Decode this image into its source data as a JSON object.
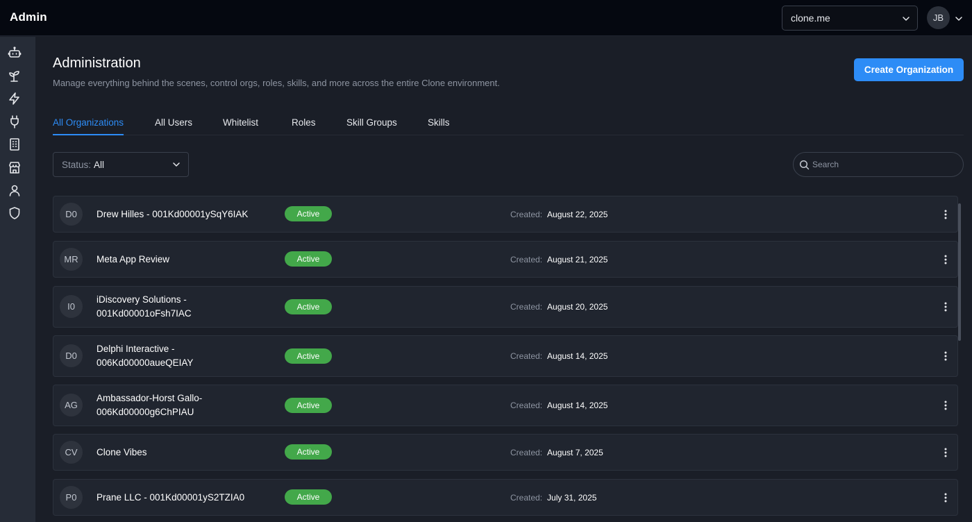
{
  "app": {
    "title": "Admin"
  },
  "header": {
    "org_selector": "clone.me",
    "user_initials": "JB"
  },
  "sidebar": {
    "items": [
      {
        "icon": "robot-icon"
      },
      {
        "icon": "sprout-icon"
      },
      {
        "icon": "lightning-icon"
      },
      {
        "icon": "plug-icon"
      },
      {
        "icon": "building-icon"
      },
      {
        "icon": "store-icon"
      },
      {
        "icon": "user-icon"
      },
      {
        "icon": "shield-icon"
      }
    ]
  },
  "page": {
    "title": "Administration",
    "subtitle": "Manage everything behind the scenes, control orgs, roles, skills, and more across the entire Clone environment.",
    "create_button": "Create Organization"
  },
  "tabs": [
    {
      "label": "All Organizations",
      "active": true
    },
    {
      "label": "All Users",
      "active": false
    },
    {
      "label": "Whitelist",
      "active": false
    },
    {
      "label": "Roles",
      "active": false
    },
    {
      "label": "Skill Groups",
      "active": false
    },
    {
      "label": "Skills",
      "active": false
    }
  ],
  "filters": {
    "status_label": "Status:",
    "status_value": "All",
    "search_placeholder": "Search"
  },
  "organizations": [
    {
      "initials": "D0",
      "name_line1": "Drew Hilles - 001Kd00001ySqY6IAK",
      "name_line2": "",
      "status": "Active",
      "created_label": "Created:",
      "created": "August 22, 2025"
    },
    {
      "initials": "MR",
      "name_line1": "Meta App Review",
      "name_line2": "",
      "status": "Active",
      "created_label": "Created:",
      "created": "August 21, 2025"
    },
    {
      "initials": "I0",
      "name_line1": "iDiscovery Solutions -",
      "name_line2": "001Kd00001oFsh7IAC",
      "status": "Active",
      "created_label": "Created:",
      "created": "August 20, 2025"
    },
    {
      "initials": "D0",
      "name_line1": "Delphi Interactive -",
      "name_line2": "006Kd00000aueQEIAY",
      "status": "Active",
      "created_label": "Created:",
      "created": "August 14, 2025"
    },
    {
      "initials": "AG",
      "name_line1": "Ambassador-Horst Gallo-",
      "name_line2": "006Kd00000g6ChPIAU",
      "status": "Active",
      "created_label": "Created:",
      "created": "August 14, 2025"
    },
    {
      "initials": "CV",
      "name_line1": "Clone Vibes",
      "name_line2": "",
      "status": "Active",
      "created_label": "Created:",
      "created": "August 7, 2025"
    },
    {
      "initials": "P0",
      "name_line1": "Prane LLC - 001Kd00001yS2TZIA0",
      "name_line2": "",
      "status": "Active",
      "created_label": "Created:",
      "created": "July 31, 2025"
    }
  ],
  "colors": {
    "accent": "#2d8cf6",
    "active_badge": "#43a84a",
    "background": "#1a1e27",
    "topbar": "#050810",
    "sidebar": "#262c37"
  }
}
